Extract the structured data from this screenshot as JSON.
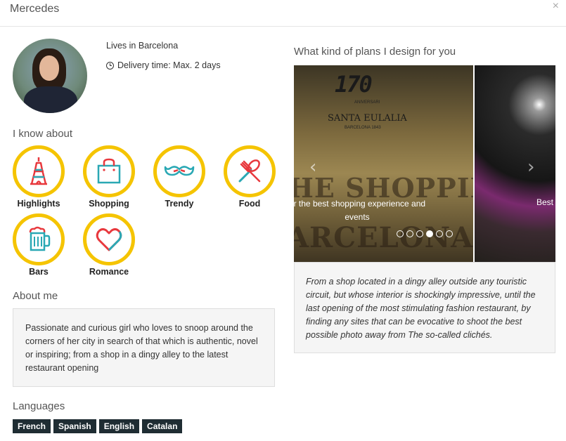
{
  "header": {
    "title": "Mercedes",
    "close_glyph": "×"
  },
  "profile": {
    "location": "Lives in Barcelona",
    "delivery": "Delivery time: Max. 2 days"
  },
  "know_about": {
    "heading": "I know about",
    "items": [
      {
        "label": "Highlights",
        "icon": "eiffel-tower-icon"
      },
      {
        "label": "Shopping",
        "icon": "shopping-bag-icon"
      },
      {
        "label": "Trendy",
        "icon": "mustache-icon"
      },
      {
        "label": "Food",
        "icon": "fork-knife-icon"
      },
      {
        "label": "Bars",
        "icon": "beer-mug-icon"
      },
      {
        "label": "Romance",
        "icon": "heart-icon"
      }
    ],
    "ring_color": "#f5c400",
    "icon_red": "#e8383d",
    "icon_teal": "#2aa8b4"
  },
  "about": {
    "heading": "About me",
    "text": "Passionate and curious girl who loves to snoop around the corners of her city in search of that which is authentic, novel or inspiring; from a shop in a dingy alley to the latest restaurant opening"
  },
  "languages": {
    "heading": "Languages",
    "items": [
      "French",
      "Spanish",
      "English",
      "Catalan"
    ]
  },
  "plans": {
    "heading": "What kind of plans I design for you",
    "slide1": {
      "logo": "170",
      "aniv": "ANIVERSARI",
      "brand": "SANTA EULALIA",
      "brand_sub": "BARCELONA 1843",
      "big_line1": "HE SHOPPING",
      "big_line2": "ARCELONA",
      "caption": "er the best shopping experience and events"
    },
    "slide2": {
      "caption": "Best"
    },
    "prev_glyph": "‹",
    "next_glyph": "›",
    "dots_total": 6,
    "dots_active": 4,
    "description": "From a shop located in a dingy alley outside any touristic circuit, but whose interior is shockingly impressive, until the last opening of the most stimulating fashion restaurant, by finding any sites that can be evocative to shoot the best possible photo away from The so-called clichés."
  }
}
